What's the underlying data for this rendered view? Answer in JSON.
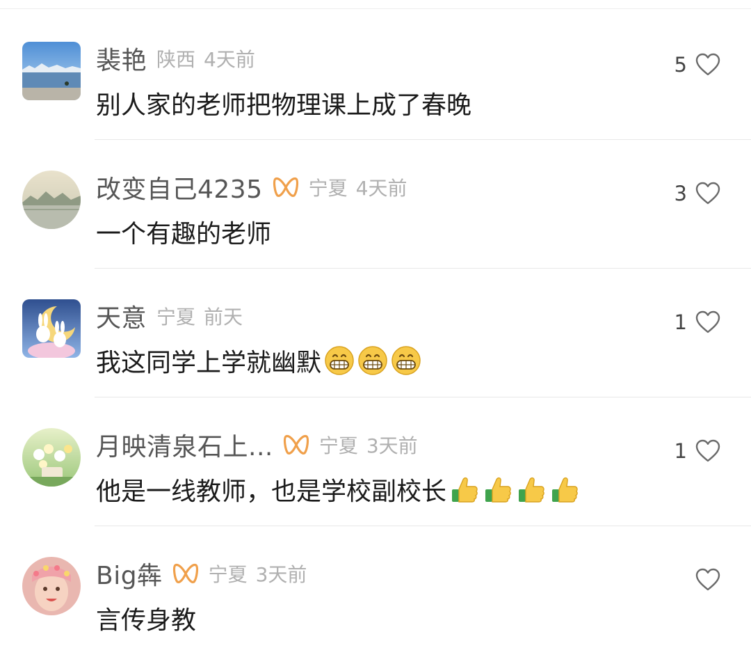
{
  "comments": [
    {
      "name": "裴艳",
      "badge": false,
      "region": "陕西",
      "time": "4天前",
      "text": "别人家的老师把物理课上成了春晚",
      "emoji": "",
      "emoji_count": 0,
      "likes": "5",
      "avatar_icon": "lake-avatar-icon"
    },
    {
      "name": "改变自己4235",
      "badge": true,
      "region": "宁夏",
      "time": "4天前",
      "text": "一个有趣的老师",
      "emoji": "",
      "emoji_count": 0,
      "likes": "3",
      "avatar_icon": "landscape-avatar-icon"
    },
    {
      "name": "天意",
      "badge": false,
      "region": "宁夏",
      "time": "前天",
      "text": "我这同学上学就幽默",
      "emoji": "grin-emoji-icon",
      "emoji_count": 3,
      "likes": "1",
      "avatar_icon": "bunny-avatar-icon"
    },
    {
      "name": "月映清泉石上...",
      "badge": true,
      "region": "宁夏",
      "time": "3天前",
      "text": "他是一线教师，也是学校副校长",
      "emoji": "thumbs-up-emoji-icon",
      "emoji_count": 4,
      "likes": "1",
      "avatar_icon": "flowers-avatar-icon"
    },
    {
      "name": "Big犇",
      "badge": true,
      "region": "宁夏",
      "time": "3天前",
      "text": "言传身教",
      "emoji": "",
      "emoji_count": 0,
      "likes": "",
      "avatar_icon": "child-avatar-icon"
    }
  ],
  "colors": {
    "badge": "#f0a04b",
    "name": "#565656",
    "meta": "#b0b0b0",
    "text": "#1b1b1b"
  },
  "icons": {
    "like": "heart-outline-icon",
    "badge": "bow-badge-icon"
  }
}
